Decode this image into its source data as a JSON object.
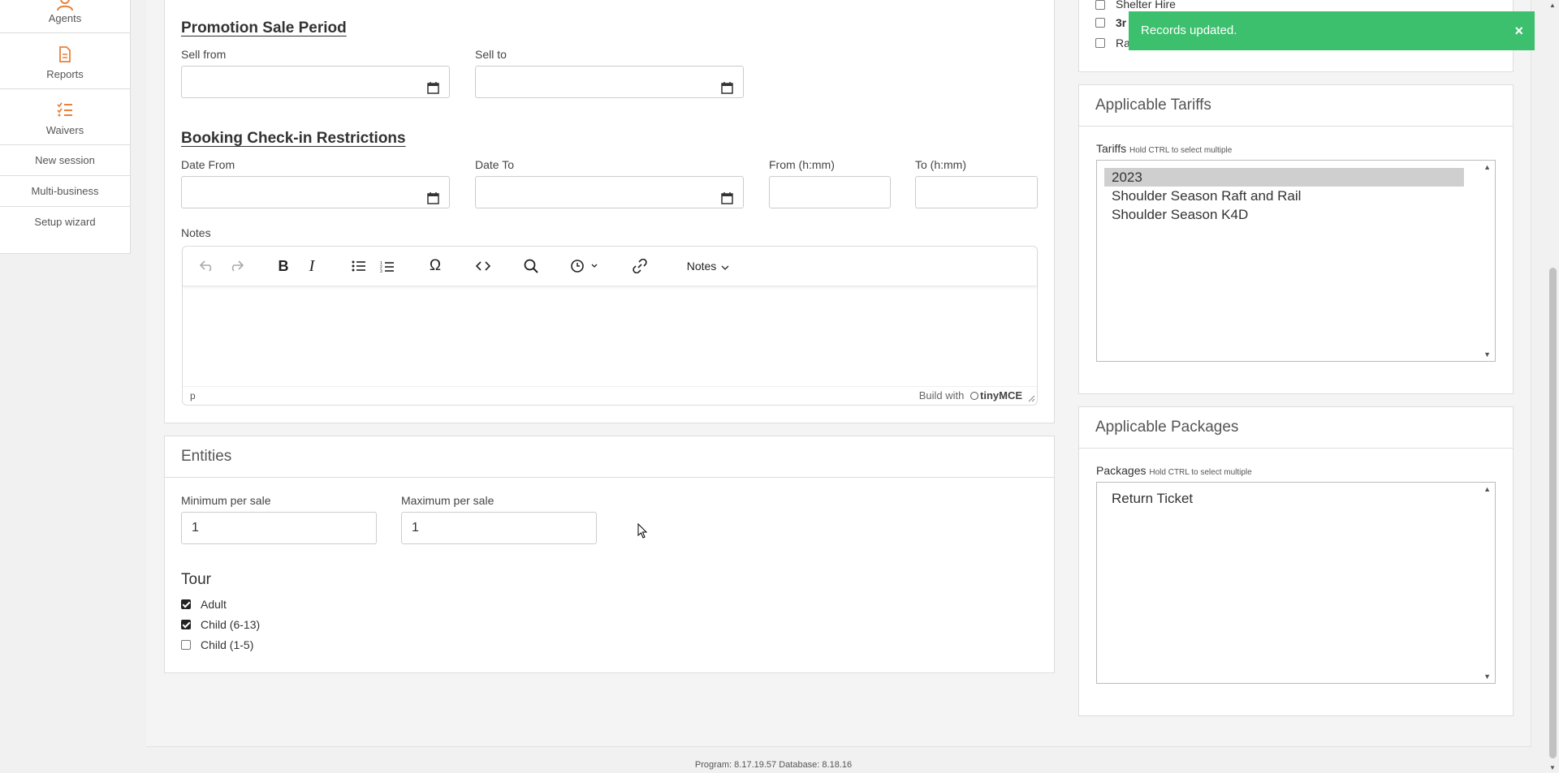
{
  "sidebar": {
    "items": [
      {
        "label": "Agents",
        "icon": "agents-icon"
      },
      {
        "label": "Reports",
        "icon": "report-icon"
      },
      {
        "label": "Waivers",
        "icon": "checklist-icon"
      }
    ],
    "links": [
      "New session",
      "Multi-business",
      "Setup wizard"
    ]
  },
  "promo": {
    "title": "Promotion Sale Period",
    "sell_from_label": "Sell from",
    "sell_to_label": "Sell to",
    "sell_from_value": "",
    "sell_to_value": ""
  },
  "checkin": {
    "title": "Booking Check-in Restrictions",
    "date_from_label": "Date From",
    "date_to_label": "Date To",
    "from_time_label": "From (h:mm)",
    "to_time_label": "To (h:mm)",
    "date_from_value": "",
    "date_to_value": "",
    "from_time_value": "",
    "to_time_value": ""
  },
  "notes": {
    "label": "Notes",
    "toolbar_menu": "Notes",
    "status_path": "p",
    "branding": "Build with",
    "brand_name": "tinyMCE"
  },
  "entities": {
    "title": "Entities",
    "min_label": "Minimum per sale",
    "max_label": "Maximum per sale",
    "min_value": "1",
    "max_value": "1",
    "group_title": "Tour",
    "options": [
      {
        "label": "Adult",
        "checked": true
      },
      {
        "label": "Child (6-13)",
        "checked": true
      },
      {
        "label": "Child (1-5)",
        "checked": false
      }
    ]
  },
  "top_right_checks": [
    {
      "label": "Shelter Hire",
      "checked": false
    },
    {
      "label": "3r",
      "checked": false
    },
    {
      "label": "Ra",
      "checked": false
    }
  ],
  "tariffs": {
    "panel_title": "Applicable Tariffs",
    "label": "Tariffs",
    "hint": "Hold CTRL to select multiple",
    "options": [
      "2023",
      "Shoulder Season Raft and Rail",
      "Shoulder Season K4D"
    ],
    "selected_index": 0
  },
  "packages": {
    "panel_title": "Applicable Packages",
    "label": "Packages",
    "hint": "Hold CTRL to select multiple",
    "options": [
      "Return Ticket"
    ]
  },
  "toast": {
    "message": "Records updated.",
    "close": "×",
    "color": "#3cc06d"
  },
  "footer": {
    "text": "Program: 8.17.19.57 Database: 8.18.16"
  },
  "colors": {
    "accent": "#e8813a"
  }
}
